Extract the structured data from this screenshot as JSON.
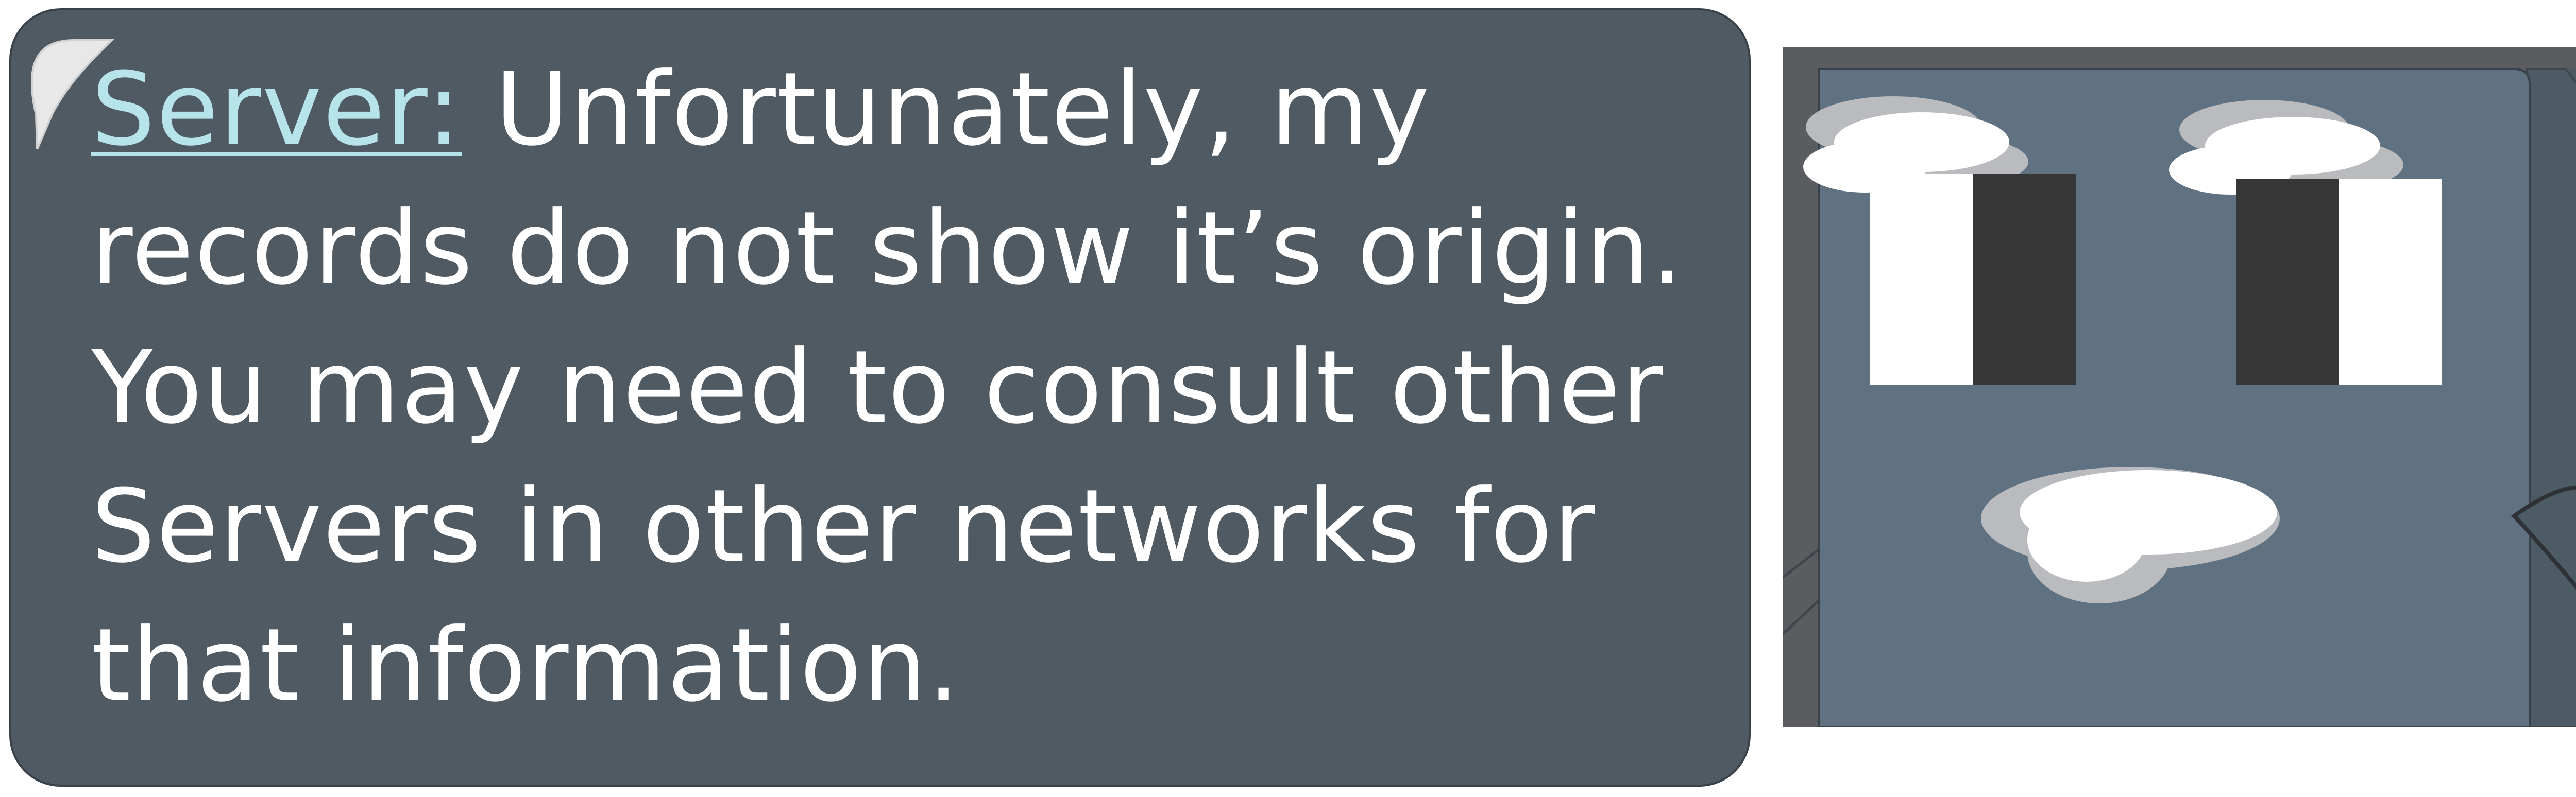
{
  "dialog": {
    "speaker": "Server:",
    "message": "Unfortunately, my records do not show it’s origin. You may need to consult other Servers in other networks for that information."
  },
  "portrait": {
    "character": "server",
    "icons": [
      "speech-bubble-corner-icon",
      "server-face-icon"
    ]
  },
  "colors": {
    "dialog_background": "#4f5a63",
    "speaker_text": "#b7e3ea",
    "dialog_text": "#ffffff",
    "server_body": "#607282"
  }
}
